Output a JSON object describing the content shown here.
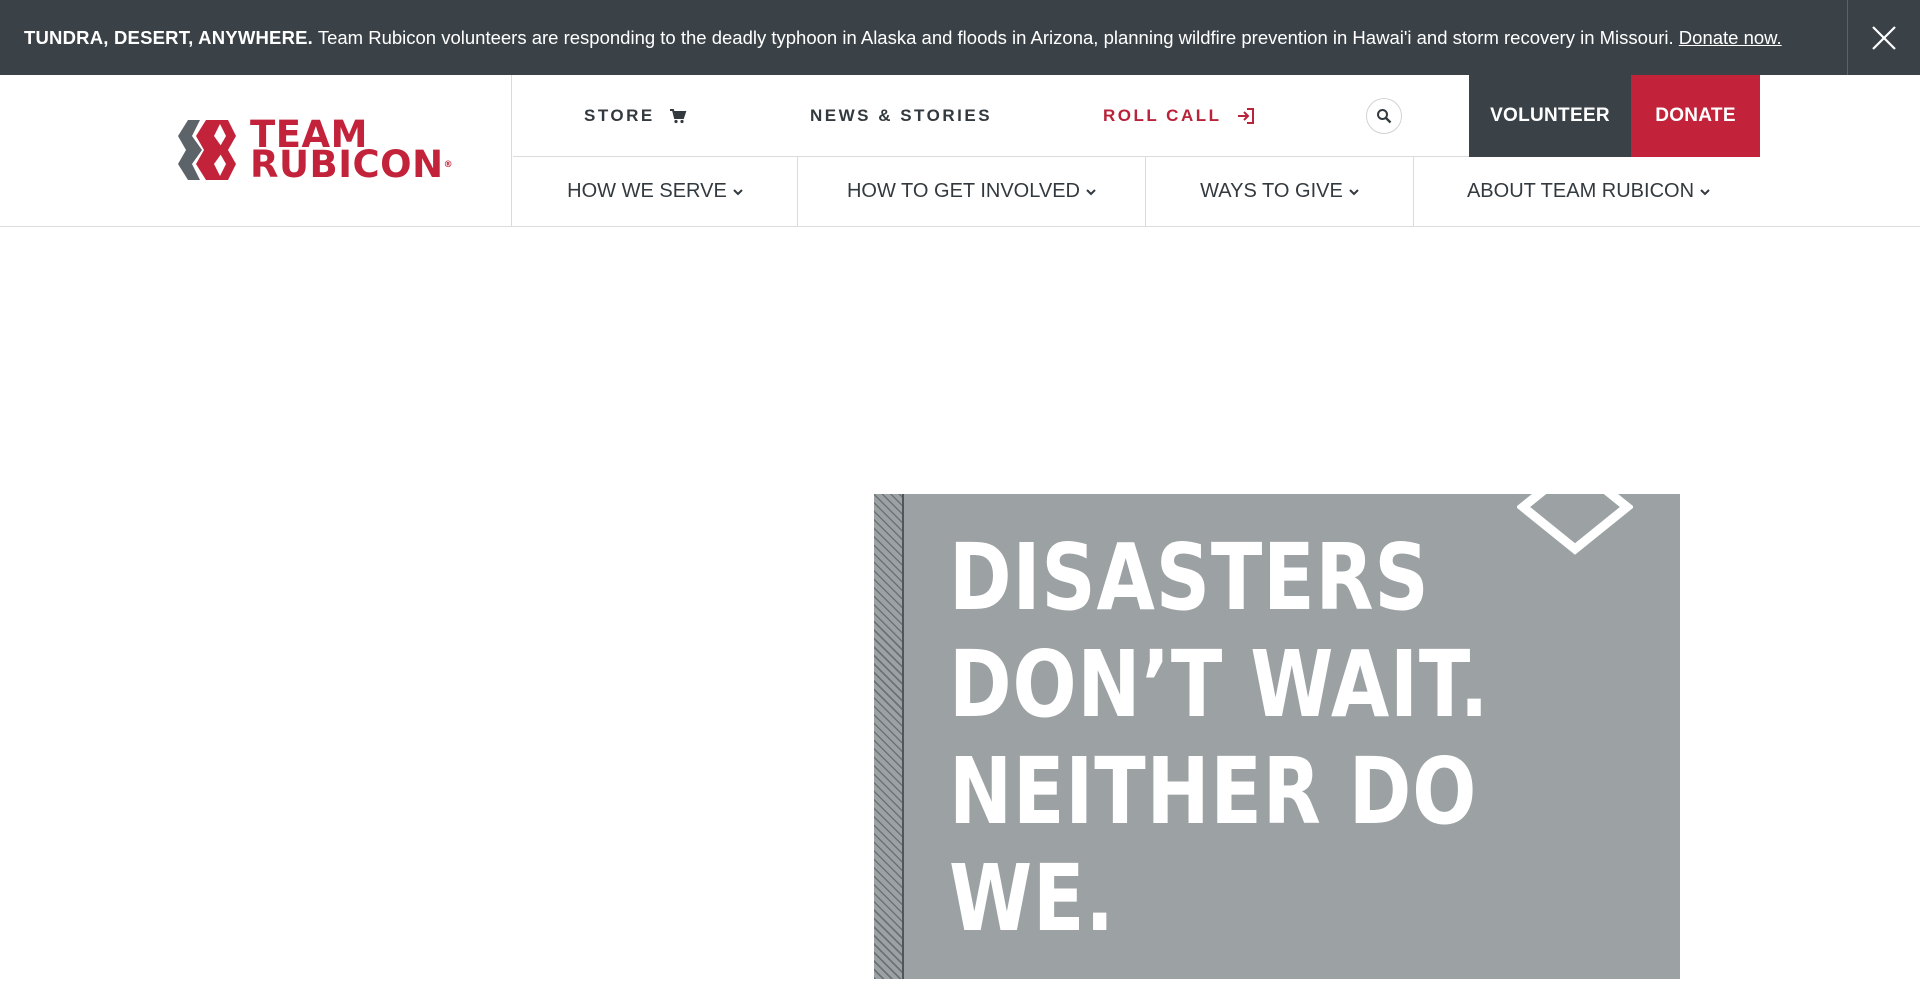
{
  "alert": {
    "strong": "TUNDRA, DESERT, ANYWHERE.",
    "message": " Team Rubicon volunteers are responding to the deadly typhoon in Alaska and floods in Arizona, planning wildfire prevention in Hawai'i and storm recovery in Missouri. ",
    "link": "Donate now."
  },
  "logo": {
    "line1": "TEAM",
    "line2": "RUBICON",
    "reg": "®"
  },
  "utility_nav": {
    "store": "STORE",
    "news": "NEWS & STORIES",
    "roll_call": "ROLL CALL"
  },
  "buttons": {
    "volunteer": "VOLUNTEER",
    "donate": "DONATE"
  },
  "main_nav": [
    {
      "label": "HOW WE SERVE"
    },
    {
      "label": "HOW TO GET INVOLVED"
    },
    {
      "label": "WAYS TO GIVE"
    },
    {
      "label": "ABOUT TEAM RUBICON"
    }
  ],
  "hero": {
    "lines": [
      "DISASTERS",
      "DON’T WAIT.",
      "NEITHER DO",
      "WE."
    ]
  },
  "colors": {
    "brand_red": "#c3233a",
    "dark_slate": "#3a4248",
    "hero_gray": "#9ca1a4"
  }
}
